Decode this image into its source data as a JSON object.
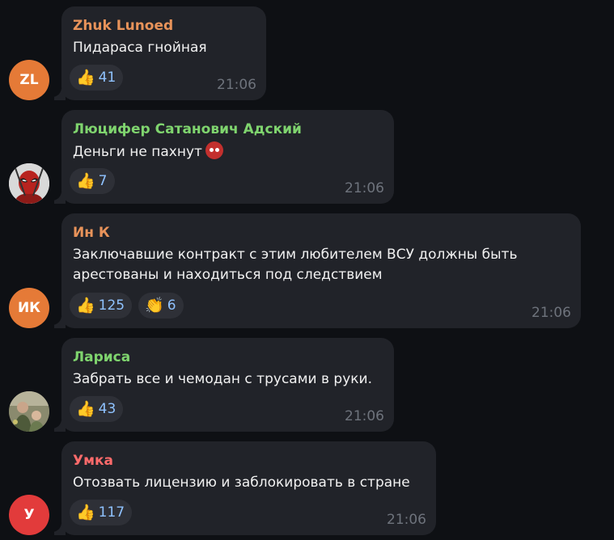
{
  "messages": [
    {
      "author": "Zhuk Lunoed",
      "author_color": "#e8935a",
      "avatar_initials": "ZL",
      "avatar_color": "#e57a37",
      "text_lines": [
        "Пидараса гнойная"
      ],
      "reactions": [
        {
          "emoji": "👍",
          "icon": "thumbs-up-icon",
          "count": "41"
        }
      ],
      "time": "21:06"
    },
    {
      "author": "Люцифер Сатанович Адский",
      "author_color": "#7fd46e",
      "avatar_initials": "",
      "avatar_color": "#e9e9e9",
      "text_lines": [
        "Деньги не пахнут"
      ],
      "inline_emoji": "devil-face-icon",
      "reactions": [
        {
          "emoji": "👍",
          "icon": "thumbs-up-icon",
          "count": "7"
        }
      ],
      "time": "21:06"
    },
    {
      "author": "Ин К",
      "author_color": "#e8935a",
      "avatar_initials": "ИК",
      "avatar_color": "#e57a37",
      "text_lines": [
        "Заключавшие контракт с этим любителем ВСУ должны быть",
        "арестованы и находиться под следствием"
      ],
      "reactions": [
        {
          "emoji": "👍",
          "icon": "thumbs-up-icon",
          "count": "125"
        },
        {
          "emoji": "👏",
          "icon": "clapping-hands-icon",
          "count": "6"
        }
      ],
      "time": "21:06"
    },
    {
      "author": "Лариса",
      "author_color": "#7fd46e",
      "avatar_initials": "",
      "avatar_color": "#6f6d55",
      "text_lines": [
        "Забрать все и чемодан с трусами в руки."
      ],
      "reactions": [
        {
          "emoji": "👍",
          "icon": "thumbs-up-icon",
          "count": "43"
        }
      ],
      "time": "21:06"
    },
    {
      "author": "Умка",
      "author_color": "#ff6b6b",
      "avatar_initials": "У",
      "avatar_color": "#e23b3b",
      "text_lines": [
        "Отозвать лицензию и заблокировать в стране"
      ],
      "reactions": [
        {
          "emoji": "👍",
          "icon": "thumbs-up-icon",
          "count": "117"
        }
      ],
      "time": "21:06"
    }
  ]
}
